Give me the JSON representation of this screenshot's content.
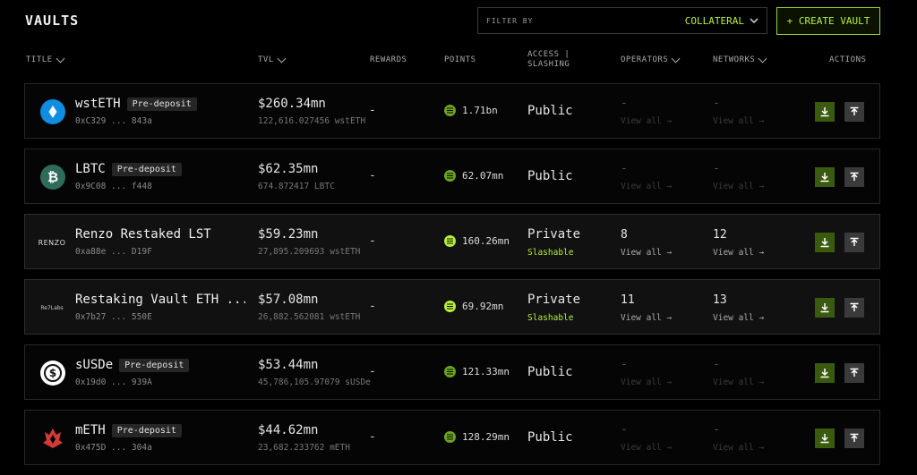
{
  "header": {
    "title": "VAULTS",
    "filter_label": "FILTER BY",
    "filter_value": "COLLATERAL",
    "create_button": "+ CREATE VAULT"
  },
  "columns": {
    "title": "TITLE",
    "tvl": "TVL",
    "rewards": "REWARDS",
    "points": "POINTS",
    "access_line1": "ACCESS |",
    "access_line2": "SLASHING",
    "operators": "OPERATORS",
    "networks": "NETWORKS",
    "actions": "ACTIONS"
  },
  "rows": [
    {
      "name": "wstETH",
      "badge": "Pre-deposit",
      "address": "0xC329 ... 843a",
      "tvl": "$260.34mn",
      "tvl_sub": "122,616.027456 wstETH",
      "rewards": "-",
      "points": "1.71bn",
      "access": "Public",
      "slashing": "",
      "operators": "-",
      "networks": "-",
      "view_ops": "View all →",
      "view_nets": "View all →",
      "icon": "wsteth-icon"
    },
    {
      "name": "LBTC",
      "badge": "Pre-deposit",
      "address": "0x9C08 ... f448",
      "tvl": "$62.35mn",
      "tvl_sub": "674.872417 LBTC",
      "rewards": "-",
      "points": "62.07mn",
      "access": "Public",
      "slashing": "",
      "operators": "-",
      "networks": "-",
      "view_ops": "View all →",
      "view_nets": "View all →",
      "icon": "lbtc-icon"
    },
    {
      "name": "Renzo Restaked LST",
      "badge": "",
      "address": "0xa88e ... D19F",
      "tvl": "$59.23mn",
      "tvl_sub": "27,895.209693 wstETH",
      "rewards": "-",
      "points": "160.26mn",
      "access": "Private",
      "slashing": "Slashable",
      "operators": "8",
      "networks": "12",
      "view_ops": "View all →",
      "view_nets": "View all →",
      "icon": "renzo-icon",
      "logo_text": "RENZO"
    },
    {
      "name": "Restaking Vault ETH ...",
      "badge": "",
      "address": "0x7b27 ... 550E",
      "tvl": "$57.08mn",
      "tvl_sub": "26,882.562081 wstETH",
      "rewards": "-",
      "points": "69.92mn",
      "access": "Private",
      "slashing": "Slashable",
      "operators": "11",
      "networks": "13",
      "view_ops": "View all →",
      "view_nets": "View all →",
      "icon": "restaking-vault-icon",
      "logo_text": "Re7Labs"
    },
    {
      "name": "sUSDe",
      "badge": "Pre-deposit",
      "address": "0x19d0 ... 939A",
      "tvl": "$53.44mn",
      "tvl_sub": "45,786,105.97079 sUSDe",
      "rewards": "-",
      "points": "121.33mn",
      "access": "Public",
      "slashing": "",
      "operators": "-",
      "networks": "-",
      "view_ops": "View all →",
      "view_nets": "View all →",
      "icon": "susde-icon"
    },
    {
      "name": "mETH",
      "badge": "Pre-deposit",
      "address": "0x475D ... 304a",
      "tvl": "$44.62mn",
      "tvl_sub": "23,682.233762 mETH",
      "rewards": "-",
      "points": "128.29mn",
      "access": "Public",
      "slashing": "",
      "operators": "-",
      "networks": "-",
      "view_ops": "View all →",
      "view_nets": "View all →",
      "icon": "meth-icon"
    }
  ],
  "colors": {
    "accent": "#b6f03c",
    "background": "#000000"
  }
}
